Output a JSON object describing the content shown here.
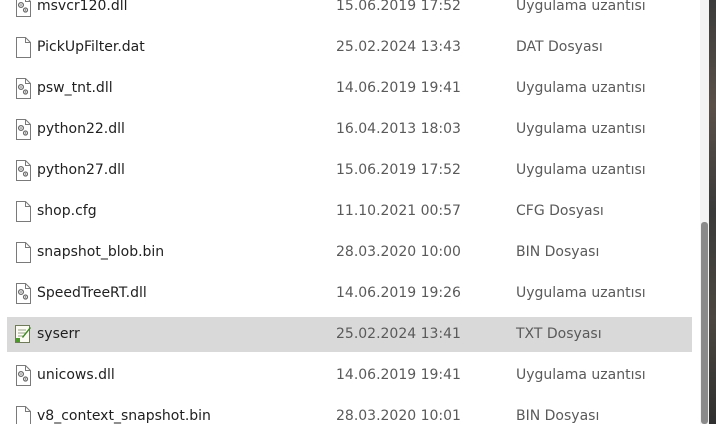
{
  "files": [
    {
      "name": "msvcr120.dll",
      "date": "15.06.2019 17:52",
      "type": "Uygulama uzantısı",
      "icon": "dll-file-icon",
      "selected": false
    },
    {
      "name": "PickUpFilter.dat",
      "date": "25.02.2024 13:43",
      "type": "DAT Dosyası",
      "icon": "blank-file-icon",
      "selected": false
    },
    {
      "name": "psw_tnt.dll",
      "date": "14.06.2019 19:41",
      "type": "Uygulama uzantısı",
      "icon": "dll-file-icon",
      "selected": false
    },
    {
      "name": "python22.dll",
      "date": "16.04.2013 18:03",
      "type": "Uygulama uzantısı",
      "icon": "dll-file-icon",
      "selected": false
    },
    {
      "name": "python27.dll",
      "date": "15.06.2019 17:52",
      "type": "Uygulama uzantısı",
      "icon": "dll-file-icon",
      "selected": false
    },
    {
      "name": "shop.cfg",
      "date": "11.10.2021 00:57",
      "type": "CFG Dosyası",
      "icon": "blank-file-icon",
      "selected": false
    },
    {
      "name": "snapshot_blob.bin",
      "date": "28.03.2020 10:00",
      "type": "BIN Dosyası",
      "icon": "blank-file-icon",
      "selected": false
    },
    {
      "name": "SpeedTreeRT.dll",
      "date": "14.06.2019 19:26",
      "type": "Uygulama uzantısı",
      "icon": "dll-file-icon",
      "selected": false
    },
    {
      "name": "syserr",
      "date": "25.02.2024 13:41",
      "type": "TXT Dosyası",
      "icon": "text-file-icon",
      "selected": true
    },
    {
      "name": "unicows.dll",
      "date": "14.06.2019 19:41",
      "type": "Uygulama uzantısı",
      "icon": "dll-file-icon",
      "selected": false
    },
    {
      "name": "v8_context_snapshot.bin",
      "date": "28.03.2020 10:01",
      "type": "BIN Dosyası",
      "icon": "blank-file-icon",
      "selected": false
    }
  ],
  "colors": {
    "selected_row": "#d9d9d9",
    "secondary_text": "#5a5a5a",
    "scroll_thumb": "#8a8a8a"
  }
}
